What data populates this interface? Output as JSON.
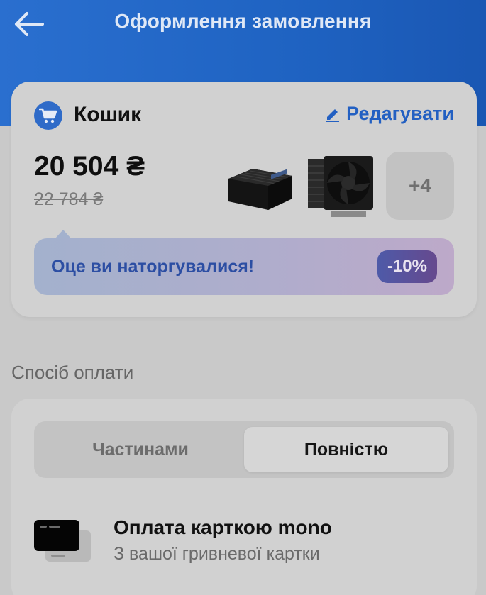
{
  "header": {
    "title": "Оформлення замовлення",
    "back_icon": "arrow-left-icon"
  },
  "cart": {
    "icon": "cart-icon",
    "title": "Кошик",
    "edit_label": "Редагувати",
    "edit_icon": "pencil-icon",
    "price_now": "20 504 ₴",
    "price_old": "22 784 ₴",
    "products": [
      {
        "name": "power-supply-image"
      },
      {
        "name": "cpu-cooler-image"
      }
    ],
    "more_count": "+4",
    "promo_text": "Оце ви наторгувалися!",
    "discount": "-10%"
  },
  "payment": {
    "section_label": "Спосіб оплати",
    "tabs": [
      {
        "label": "Частинами",
        "selected": false
      },
      {
        "label": "Повністю",
        "selected": true
      }
    ],
    "method": {
      "icon": "card-icon",
      "title": "Оплата карткою mono",
      "subtitle": "З вашої гривневої картки"
    }
  },
  "colors": {
    "header_bg": "#2266c8",
    "accent": "#2360c2",
    "promo_text": "#2c4ea3",
    "discount_bg": "#5b51a0",
    "card_bg": "#d1d1d1",
    "page_bg": "#c9c9c9"
  }
}
